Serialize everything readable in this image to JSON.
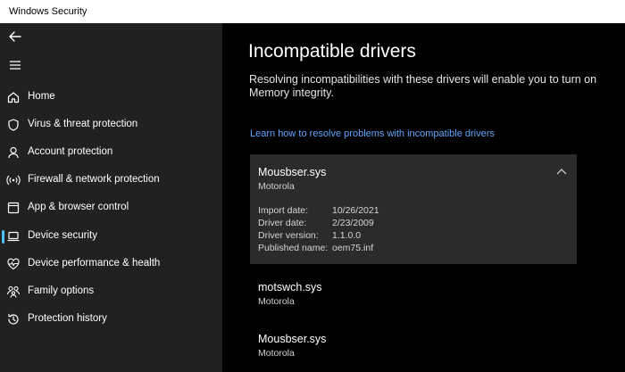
{
  "window": {
    "title": "Windows Security"
  },
  "sidebar": {
    "items": [
      {
        "label": "Home",
        "icon": "home-icon"
      },
      {
        "label": "Virus & threat protection",
        "icon": "shield-icon"
      },
      {
        "label": "Account protection",
        "icon": "person-icon"
      },
      {
        "label": "Firewall & network protection",
        "icon": "wifi-icon"
      },
      {
        "label": "App & browser control",
        "icon": "app-window-icon"
      },
      {
        "label": "Device security",
        "icon": "laptop-icon",
        "active": true
      },
      {
        "label": "Device performance & health",
        "icon": "heart-pulse-icon"
      },
      {
        "label": "Family options",
        "icon": "family-icon"
      },
      {
        "label": "Protection history",
        "icon": "history-icon"
      }
    ]
  },
  "main": {
    "title": "Incompatible drivers",
    "description": "Resolving incompatibilities with these drivers will enable you to turn on Memory integrity.",
    "learn_link": "Learn how to resolve problems with incompatible drivers",
    "expanded_driver": {
      "name": "Mousbser.sys",
      "vendor": "Motorola",
      "properties": [
        {
          "key": "Import date:",
          "value": "10/26/2021"
        },
        {
          "key": "Driver date:",
          "value": "2/23/2009"
        },
        {
          "key": "Driver version:",
          "value": "1.1.0.0"
        },
        {
          "key": "Published name:",
          "value": "oem75.inf"
        }
      ]
    },
    "drivers": [
      {
        "name": "motswch.sys",
        "vendor": "Motorola"
      },
      {
        "name": "Mousbser.sys",
        "vendor": "Motorola"
      }
    ]
  },
  "colors": {
    "accent": "#4cc2ff",
    "link": "#5ea6ff",
    "sidebar_bg": "#212121",
    "card_bg": "#2b2b2b"
  }
}
